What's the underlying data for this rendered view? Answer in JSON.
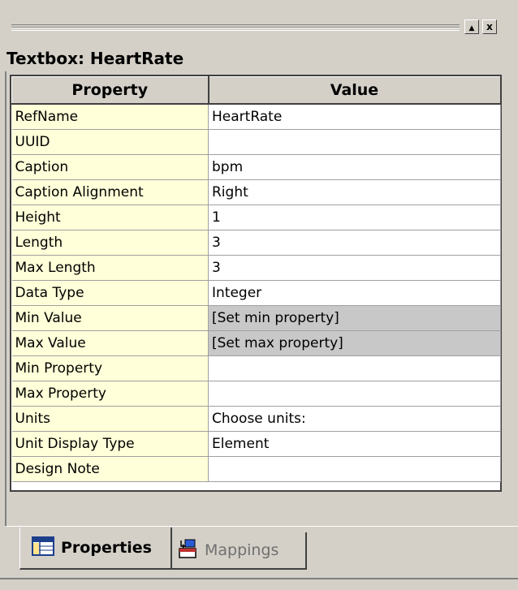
{
  "panel": {
    "title": "Textbox: HeartRate",
    "buttons": {
      "arrow": "▲",
      "close": "x"
    }
  },
  "table": {
    "headers": {
      "property": "Property",
      "value": "Value"
    },
    "rows": [
      {
        "property": "RefName",
        "value": "HeartRate",
        "highlight": false
      },
      {
        "property": "UUID",
        "value": "",
        "highlight": false
      },
      {
        "property": "Caption",
        "value": "bpm",
        "highlight": false
      },
      {
        "property": "Caption Alignment",
        "value": "Right",
        "highlight": false
      },
      {
        "property": "Height",
        "value": "1",
        "highlight": false
      },
      {
        "property": "Length",
        "value": "3",
        "highlight": false
      },
      {
        "property": "Max Length",
        "value": "3",
        "highlight": false
      },
      {
        "property": "Data Type",
        "value": "Integer",
        "highlight": false
      },
      {
        "property": "Min Value",
        "value": "[Set min property]",
        "highlight": true
      },
      {
        "property": "Max Value",
        "value": "[Set max property]",
        "highlight": true
      },
      {
        "property": "Min Property",
        "value": "",
        "highlight": false
      },
      {
        "property": "Max Property",
        "value": "",
        "highlight": false
      },
      {
        "property": "Units",
        "value": "Choose units:",
        "highlight": false
      },
      {
        "property": "Unit Display Type",
        "value": "Element",
        "highlight": false
      },
      {
        "property": "Design Note",
        "value": "",
        "highlight": false
      }
    ]
  },
  "tabs": [
    {
      "label": "Properties",
      "icon": "properties-grid-icon",
      "active": true
    },
    {
      "label": "Mappings",
      "icon": "mappings-icon",
      "active": false
    }
  ],
  "colors": {
    "property_cell_bg": "#ffffd9",
    "highlight_value_bg": "#c8c8c8",
    "chrome": "#d4d0c8"
  }
}
